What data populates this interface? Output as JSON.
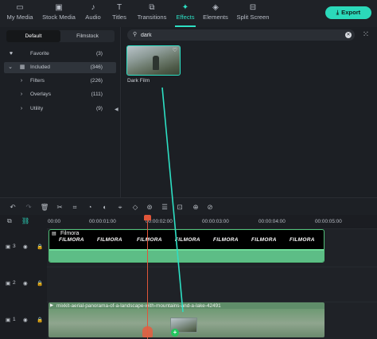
{
  "toolbar": {
    "tabs": [
      {
        "label": "My Media",
        "icon": "media-icon"
      },
      {
        "label": "Stock Media",
        "icon": "stock-media-icon"
      },
      {
        "label": "Audio",
        "icon": "music-note-icon"
      },
      {
        "label": "Titles",
        "icon": "titles-icon"
      },
      {
        "label": "Transitions",
        "icon": "transitions-icon"
      },
      {
        "label": "Effects",
        "icon": "effects-sparkle-icon",
        "active": true
      },
      {
        "label": "Elements",
        "icon": "elements-icon"
      },
      {
        "label": "Split Screen",
        "icon": "split-screen-icon"
      }
    ],
    "export_label": "Export"
  },
  "left_panel": {
    "subtabs": [
      "Default",
      "Filmstock"
    ],
    "active_subtab": "Default",
    "items": [
      {
        "label": "Favorite",
        "count": "(3)",
        "icon": "heart-icon"
      },
      {
        "label": "Included",
        "count": "(346)",
        "icon": "grid-icon",
        "selected": true
      },
      {
        "label": "Filters",
        "count": "(226)",
        "icon": "chevron-right-icon"
      },
      {
        "label": "Overlays",
        "count": "(111)",
        "icon": "chevron-right-icon"
      },
      {
        "label": "Utility",
        "count": "(9)",
        "icon": "chevron-right-icon"
      }
    ]
  },
  "right_panel": {
    "search": {
      "value": "dark",
      "placeholder": ""
    },
    "results": [
      {
        "title": "Dark Film"
      }
    ]
  },
  "timeline": {
    "timecodes": [
      "00:00",
      "00:00:01:00",
      "00:00:02:00",
      "00:00:03:00",
      "00:00:04:00",
      "00:00:05:00"
    ],
    "tracks": [
      {
        "number": "3",
        "clip": {
          "name": "Filmora",
          "watermark": "FILMORA",
          "type": "title"
        }
      },
      {
        "number": "2",
        "clip": null
      },
      {
        "number": "1",
        "clip": {
          "name": "mixkit-aerial-panorama-of-a-landscape-with-mountains-and-a-lake-42491",
          "type": "video"
        }
      }
    ]
  },
  "colors": {
    "accent": "#2de0c4",
    "export_bg": "#2bd9ba",
    "playhead": "#e0563a",
    "track_clip_green": "#5dbd86",
    "add_badge": "#23c55e"
  }
}
